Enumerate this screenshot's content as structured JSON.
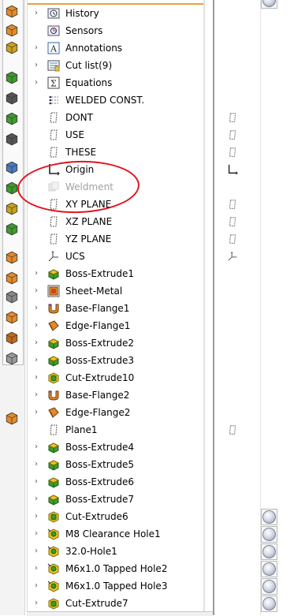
{
  "feature_tree": {
    "items": [
      {
        "label": "History",
        "icon": "history-icon",
        "expandable": true
      },
      {
        "label": "Sensors",
        "icon": "sensors-icon",
        "expandable": false
      },
      {
        "label": "Annotations",
        "icon": "annotations-icon",
        "expandable": true
      },
      {
        "label": "Cut list(9)",
        "icon": "cut-list-icon",
        "expandable": true
      },
      {
        "label": "Equations",
        "icon": "equations-icon",
        "expandable": true
      },
      {
        "label": "WELDED CONST.",
        "icon": "material-icon",
        "expandable": false
      },
      {
        "label": "DONT",
        "icon": "plane-icon",
        "expandable": false
      },
      {
        "label": "USE",
        "icon": "plane-icon",
        "expandable": false
      },
      {
        "label": "THESE",
        "icon": "plane-icon",
        "expandable": false
      },
      {
        "label": "Origin",
        "icon": "origin-icon",
        "expandable": false
      },
      {
        "label": "Weldment",
        "icon": "weldment-icon",
        "expandable": false,
        "suppressed": true
      },
      {
        "label": "XY PLANE",
        "icon": "plane-icon",
        "expandable": false
      },
      {
        "label": "XZ PLANE",
        "icon": "plane-icon",
        "expandable": false
      },
      {
        "label": "YZ PLANE",
        "icon": "plane-icon",
        "expandable": false
      },
      {
        "label": "UCS",
        "icon": "coordinate-system-icon",
        "expandable": false
      },
      {
        "label": "Boss-Extrude1",
        "icon": "boss-extrude-icon",
        "expandable": true
      },
      {
        "label": "Sheet-Metal",
        "icon": "sheet-metal-icon",
        "expandable": true
      },
      {
        "label": "Base-Flange1",
        "icon": "base-flange-icon",
        "expandable": true
      },
      {
        "label": "Edge-Flange1",
        "icon": "edge-flange-icon",
        "expandable": true
      },
      {
        "label": "Boss-Extrude2",
        "icon": "boss-extrude-icon",
        "expandable": true
      },
      {
        "label": "Boss-Extrude3",
        "icon": "boss-extrude-icon",
        "expandable": true
      },
      {
        "label": "Cut-Extrude10",
        "icon": "cut-extrude-icon",
        "expandable": true
      },
      {
        "label": "Base-Flange2",
        "icon": "base-flange-icon",
        "expandable": true
      },
      {
        "label": "Edge-Flange2",
        "icon": "edge-flange-icon",
        "expandable": true
      },
      {
        "label": "Plane1",
        "icon": "plane-icon",
        "expandable": false
      },
      {
        "label": "Boss-Extrude4",
        "icon": "boss-extrude-icon",
        "expandable": true
      },
      {
        "label": "Boss-Extrude5",
        "icon": "boss-extrude-icon",
        "expandable": true
      },
      {
        "label": "Boss-Extrude6",
        "icon": "boss-extrude-icon",
        "expandable": true
      },
      {
        "label": "Boss-Extrude7",
        "icon": "boss-extrude-icon",
        "expandable": true
      },
      {
        "label": "Cut-Extrude6",
        "icon": "cut-extrude-icon",
        "expandable": true
      },
      {
        "label": "M8 Clearance Hole1",
        "icon": "hole-wizard-icon",
        "expandable": true
      },
      {
        "label": "32.0-Hole1",
        "icon": "hole-wizard-icon",
        "expandable": true
      },
      {
        "label": "M6x1.0 Tapped Hole2",
        "icon": "hole-wizard-icon",
        "expandable": true
      },
      {
        "label": "M6x1.0 Tapped Hole3",
        "icon": "hole-wizard-icon",
        "expandable": true
      },
      {
        "label": "Cut-Extrude7",
        "icon": "cut-extrude-icon",
        "expandable": true
      }
    ]
  },
  "left_toolbar": {
    "icons": [
      "sweep-icon",
      "edge-flange-tool-icon",
      "hem-tool-icon",
      "inspect-icon",
      "weld-bead-icon",
      "reference-icon",
      "zoom-part-icon",
      "box-view-icon",
      "extrude-solid-icon",
      "boss-tool-icon",
      "flatten-icon",
      "explode-icon",
      "sheet-tool-icon",
      "lofted-bend-icon",
      "insert-part-icon",
      "rib-icon",
      "vent-icon",
      "mirror-icon"
    ]
  },
  "right_pane": {
    "plane_markers": [
      "DONT",
      "USE",
      "THESE",
      "Origin",
      "XY PLANE",
      "XZ PLANE",
      "YZ PLANE",
      "UCS",
      "Plane1"
    ],
    "appearance_balls": 6
  },
  "colors": {
    "accent_orange": "#e6a33a",
    "annotation_red": "#e0141e",
    "feature_green": "#3f9b2c",
    "feature_yellow": "#f0c419",
    "flange_orange": "#e58a2a",
    "plane_gray": "#606060"
  }
}
